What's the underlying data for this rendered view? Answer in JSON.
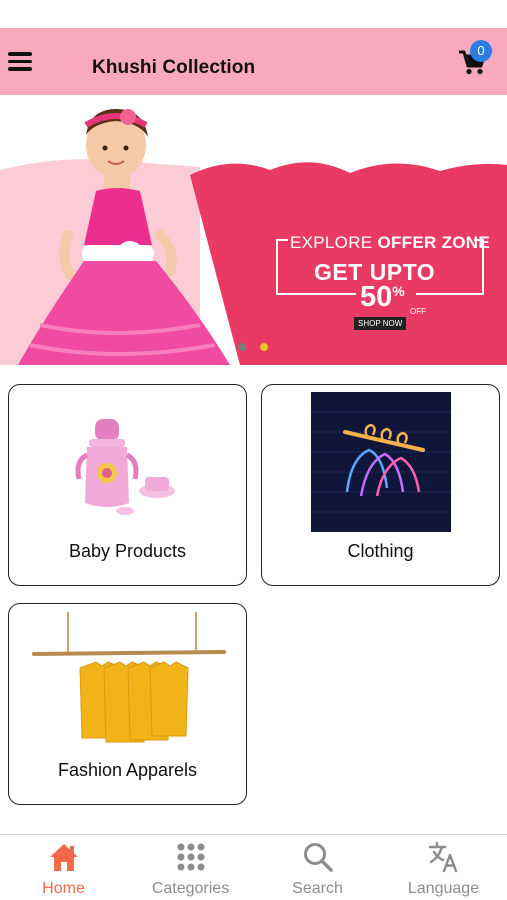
{
  "header": {
    "title": "Khushi Collection",
    "cart_count": "0",
    "menu_icon": "hamburger-menu-icon",
    "cart_icon": "shopping-cart-icon",
    "background": "#f9a9bd"
  },
  "banner": {
    "explore_light": "EXPLORE ",
    "explore_bold": "OFFER ZONE",
    "headline": "GET UPTO",
    "percent": "50",
    "percent_sign": "%",
    "off": "OFF",
    "cta": "SHOP NOW",
    "slide_count": 2,
    "active_slide": 2,
    "accent": "#e83a63"
  },
  "categories": [
    {
      "label": "Baby Products"
    },
    {
      "label": "Clothing"
    },
    {
      "label": "Fashion Apparels"
    }
  ],
  "bottom_nav": {
    "items": [
      {
        "label": "Home",
        "icon": "home-icon",
        "active": true
      },
      {
        "label": "Categories",
        "icon": "grid-icon",
        "active": false
      },
      {
        "label": "Search",
        "icon": "search-icon",
        "active": false
      },
      {
        "label": "Language",
        "icon": "translate-icon",
        "active": false
      }
    ],
    "active_color": "#f26a4b",
    "inactive_color": "#8c8c8c"
  }
}
